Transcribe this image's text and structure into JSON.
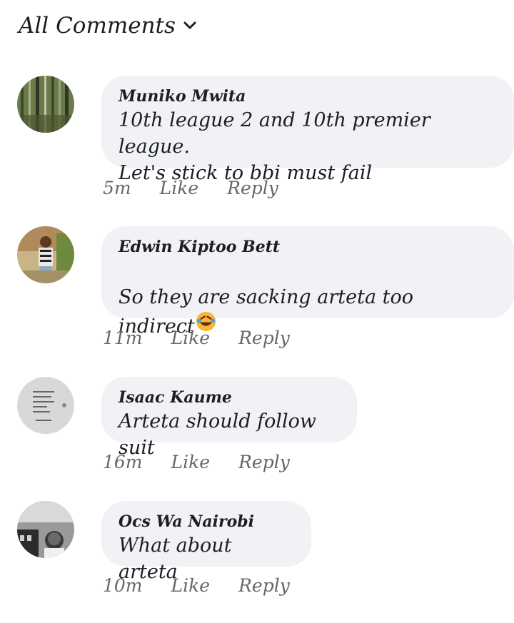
{
  "header": {
    "title": "All Comments"
  },
  "comments": [
    {
      "author": "Muniko Mwita",
      "text": "10th league 2 and 10th premier league.\nLet's stick to bbi must fail",
      "time": "5m",
      "like": "Like",
      "reply": "Reply"
    },
    {
      "author": "Edwin Kiptoo Bett",
      "text": "So they are sacking arteta too indirect",
      "emoji": [
        "rofl-emoji",
        "rofl-emoji",
        "rofl-emoji",
        "rofl-emoji"
      ],
      "time": "11m",
      "like": "Like",
      "reply": "Reply"
    },
    {
      "author": "Isaac Kaume",
      "text": "Arteta should follow suit",
      "time": "16m",
      "like": "Like",
      "reply": "Reply"
    },
    {
      "author": "Ocs Wa Nairobi",
      "text": "What about arteta",
      "time": "10m",
      "like": "Like",
      "reply": "Reply"
    }
  ],
  "colors": {
    "bubble": "#f0f2f5",
    "meta": "#65676b",
    "text": "#1c1e21"
  }
}
